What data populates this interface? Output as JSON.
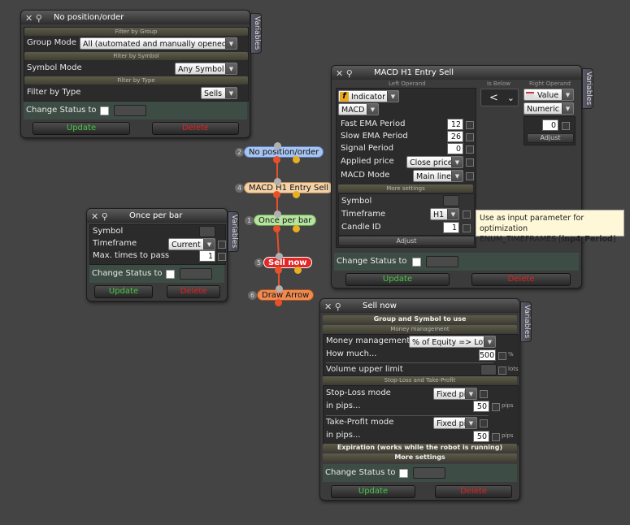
{
  "connector_color": "#e8502a",
  "panel_nopos": {
    "title": "No position/order",
    "variables_tab": "Variables",
    "sec_filter_group": "Filter by Group",
    "group_mode_label": "Group Mode",
    "group_mode_value": "All (automated and manually opened)",
    "sec_filter_symbol": "Filter by Symbol",
    "symbol_mode_label": "Symbol Mode",
    "symbol_mode_value": "Any Symbol",
    "sec_filter_type": "Filter by Type",
    "filter_type_label": "Filter by Type",
    "filter_type_value": "Sells",
    "change_status_label": "Change Status to",
    "update_label": "Update",
    "delete_label": "Delete"
  },
  "panel_macd": {
    "title": "MACD H1 Entry Sell",
    "variables_tab": "Variables",
    "left_operand_label": "Left Operand",
    "is_below_label": "Is Below",
    "right_operand_label": "Right Operand",
    "indicator_badge": "f",
    "indicator_value": "Indicator",
    "macd_value": "MACD",
    "operator_value": "<",
    "value_type": "Value",
    "numeric_value": "Numeric",
    "right_value": "0",
    "right_adjust": "Adjust",
    "fast_ema_label": "Fast EMA Period",
    "fast_ema_value": "12",
    "slow_ema_label": "Slow EMA Period",
    "slow_ema_value": "26",
    "signal_label": "Signal Period",
    "signal_value": "0",
    "applied_label": "Applied price",
    "applied_value": "Close price",
    "macd_mode_label": "MACD Mode",
    "macd_mode_value": "Main line",
    "more_settings": "More settings",
    "symbol_label": "Symbol",
    "timeframe_label": "Timeframe",
    "timeframe_value": "H1",
    "candle_label": "Candle ID",
    "candle_value": "1",
    "left_adjust": "Adjust",
    "change_status_label": "Change Status to",
    "update_label": "Update",
    "delete_label": "Delete"
  },
  "tooltip": {
    "line1": "Use as input parameter for optimization",
    "line2_prefix": "ENUM_TIMEFRAMES [",
    "line2_bold": "inp4_Period",
    "line2_suffix": "]"
  },
  "panel_once": {
    "title": "Once per bar",
    "variables_tab": "Variables",
    "symbol_label": "Symbol",
    "timeframe_label": "Timeframe",
    "timeframe_value": "Current",
    "max_label": "Max. times to pass",
    "max_value": "1",
    "change_status_label": "Change Status to",
    "update_label": "Update",
    "delete_label": "Delete"
  },
  "flow_nodes": [
    {
      "num": "2",
      "label": "No position/order",
      "color": "#a8c4f0"
    },
    {
      "num": "4",
      "label": "MACD H1 Entry Sell",
      "color": "#f4d2a8"
    },
    {
      "num": "1",
      "label": "Once per bar",
      "color": "#b6e3a0"
    },
    {
      "num": "5",
      "label": "Sell now",
      "color": "#e02828"
    },
    {
      "num": "6",
      "label": "Draw Arrow",
      "color": "#ee8a50"
    }
  ],
  "panel_sell": {
    "title": "Sell now",
    "variables_tab": "Variables",
    "sec_group_symbol": "Group and Symbol to use",
    "sec_money": "Money management",
    "money_label": "Money management",
    "money_value": "% of Equity => Lots",
    "how_much_label": "How much...",
    "how_much_value": "500",
    "how_much_unit": "%",
    "volume_label": "Volume upper limit",
    "volume_unit": "lots",
    "sec_sltp": "Stop-Loss and Take-Profit",
    "sl_mode_label": "Stop-Loss mode",
    "sl_mode_value": "Fixed pips",
    "sl_pips_label": "in pips...",
    "sl_pips_value": "50",
    "sl_unit": "pips",
    "tp_mode_label": "Take-Profit mode",
    "tp_mode_value": "Fixed pips",
    "tp_pips_label": "in pips...",
    "tp_pips_value": "50",
    "tp_unit": "pips",
    "sec_expiration": "Expiration (works while the robot is running)",
    "sec_more": "More settings",
    "change_status_label": "Change Status to",
    "update_label": "Update",
    "delete_label": "Delete"
  }
}
